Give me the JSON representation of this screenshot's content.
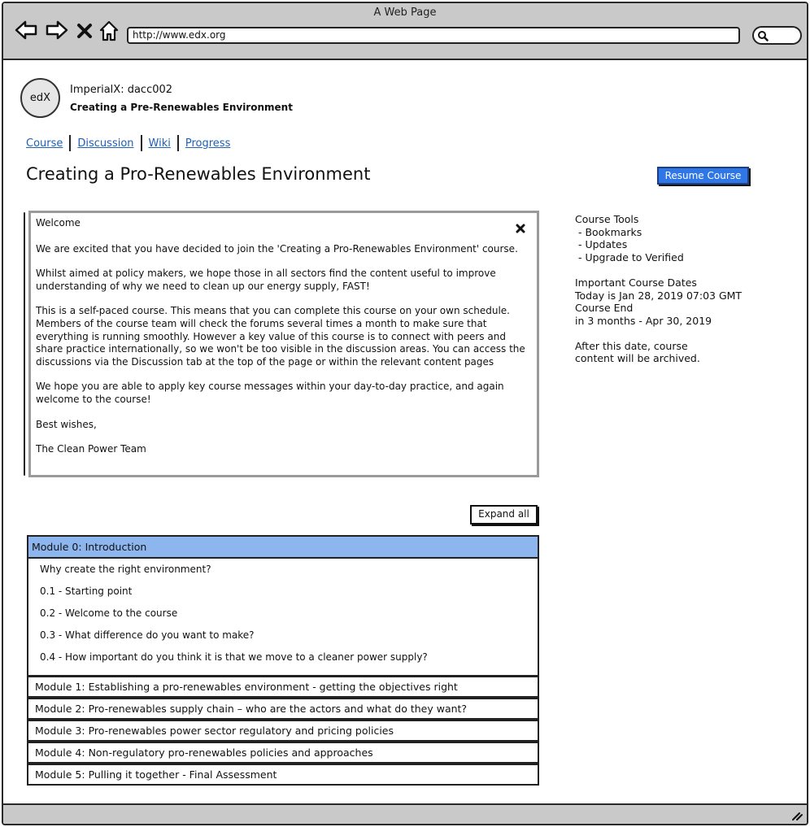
{
  "window": {
    "title": "A Web Page",
    "url": "http://www.edx.org"
  },
  "header": {
    "logo_text": "edX",
    "org_course": "ImperialX: dacc002",
    "course_name": "Creating a Pre-Renewables Environment"
  },
  "tabs": [
    "Course",
    "Discussion",
    "Wiki",
    "Progress"
  ],
  "page_title": "Creating a Pro-Renewables Environment",
  "resume_label": "Resume Course",
  "welcome": {
    "title": "Welcome",
    "paragraphs": [
      "We are excited that you have decided to join the 'Creating a Pro-Renewables Environment' course.",
      "Whilst aimed at policy makers, we hope those in all sectors find the content useful to improve understanding of why we need to clean up our energy supply, FAST!",
      "This is a self-paced course. This means that you can complete this course on your own schedule. Members of the course team will check the forums several times a month to make sure that everything is running smoothly. However a key value of this course is to connect with peers and share practice internationally, so we won't be too visible in the discussion areas. You can access the discussions via the Discussion tab at the top of the page or within the relevant content pages",
      "We hope you are able to apply key course messages within your day-to-day practice, and again welcome to the course!",
      "Best wishes,",
      "The Clean Power Team"
    ]
  },
  "sidebar": {
    "tools_title": "Course Tools",
    "tools": [
      " - Bookmarks",
      " - Updates",
      " - Upgrade to Verified"
    ],
    "dates_title": "Important Course Dates",
    "today": "Today is Jan 28, 2019 07:03 GMT",
    "course_end_label": "Course End",
    "course_end": "in 3 months - Apr 30, 2019",
    "archive_note": "After this date, course content will be archived."
  },
  "expand_label": "Expand all",
  "modules": [
    {
      "title": "Module 0: Introduction",
      "items": [
        "Why create the right environment?",
        "0.1 - Starting point",
        "0.2 - Welcome to the course",
        "0.3 - What difference do you want to make?",
        "0.4 - How important do you think it is that we move to a cleaner power supply?"
      ]
    },
    {
      "title": "Module 1: Establishing a pro-renewables environment - getting the objectives right"
    },
    {
      "title": "Module 2: Pro-renewables supply chain – who are the actors and what do they want?"
    },
    {
      "title": "Module 3: Pro-renewables power sector regulatory and pricing policies"
    },
    {
      "title": "Module 4: Non-regulatory pro-renewables policies and approaches"
    },
    {
      "title": "Module 5: Pulling it together - Final Assessment"
    }
  ]
}
